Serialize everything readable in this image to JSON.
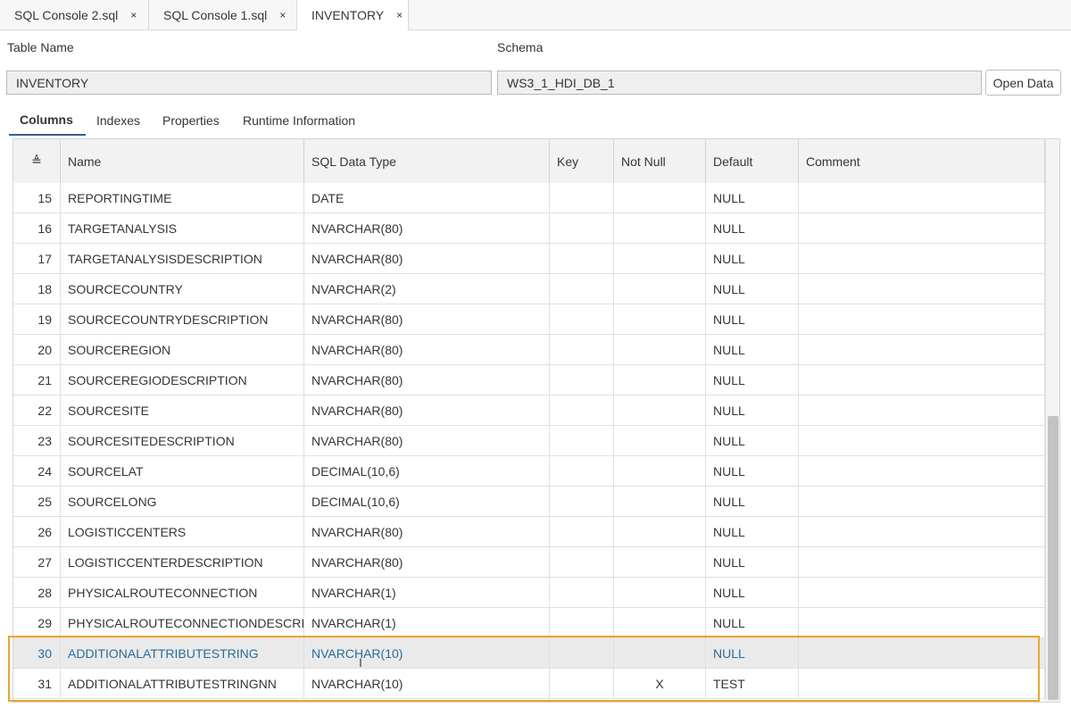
{
  "tabs": [
    {
      "label": "SQL Console 2.sql"
    },
    {
      "label": "SQL Console 1.sql"
    },
    {
      "label": "INVENTORY"
    }
  ],
  "tab_close_glyph": "×",
  "table_name": {
    "label": "Table Name",
    "value": "INVENTORY"
  },
  "schema": {
    "label": "Schema",
    "value": "WS3_1_HDI_DB_1"
  },
  "open_data_label": "Open Data",
  "subtabs": [
    "Columns",
    "Indexes",
    "Properties",
    "Runtime Information"
  ],
  "columns": {
    "sort_glyph": "≜",
    "headers": [
      "Name",
      "SQL Data Type",
      "Key",
      "Not Null",
      "Default",
      "Comment"
    ],
    "rows": [
      {
        "num": "15",
        "name": "REPORTINGTIME",
        "type": "DATE",
        "key": "",
        "notnull": "",
        "default": "NULL",
        "comment": ""
      },
      {
        "num": "16",
        "name": "TARGETANALYSIS",
        "type": "NVARCHAR(80)",
        "key": "",
        "notnull": "",
        "default": "NULL",
        "comment": ""
      },
      {
        "num": "17",
        "name": "TARGETANALYSISDESCRIPTION",
        "type": "NVARCHAR(80)",
        "key": "",
        "notnull": "",
        "default": "NULL",
        "comment": ""
      },
      {
        "num": "18",
        "name": "SOURCECOUNTRY",
        "type": "NVARCHAR(2)",
        "key": "",
        "notnull": "",
        "default": "NULL",
        "comment": ""
      },
      {
        "num": "19",
        "name": "SOURCECOUNTRYDESCRIPTION",
        "type": "NVARCHAR(80)",
        "key": "",
        "notnull": "",
        "default": "NULL",
        "comment": ""
      },
      {
        "num": "20",
        "name": "SOURCEREGION",
        "type": "NVARCHAR(80)",
        "key": "",
        "notnull": "",
        "default": "NULL",
        "comment": ""
      },
      {
        "num": "21",
        "name": "SOURCEREGIODESCRIPTION",
        "type": "NVARCHAR(80)",
        "key": "",
        "notnull": "",
        "default": "NULL",
        "comment": ""
      },
      {
        "num": "22",
        "name": "SOURCESITE",
        "type": "NVARCHAR(80)",
        "key": "",
        "notnull": "",
        "default": "NULL",
        "comment": ""
      },
      {
        "num": "23",
        "name": "SOURCESITEDESCRIPTION",
        "type": "NVARCHAR(80)",
        "key": "",
        "notnull": "",
        "default": "NULL",
        "comment": ""
      },
      {
        "num": "24",
        "name": "SOURCELAT",
        "type": "DECIMAL(10,6)",
        "key": "",
        "notnull": "",
        "default": "NULL",
        "comment": ""
      },
      {
        "num": "25",
        "name": "SOURCELONG",
        "type": "DECIMAL(10,6)",
        "key": "",
        "notnull": "",
        "default": "NULL",
        "comment": ""
      },
      {
        "num": "26",
        "name": "LOGISTICCENTERS",
        "type": "NVARCHAR(80)",
        "key": "",
        "notnull": "",
        "default": "NULL",
        "comment": ""
      },
      {
        "num": "27",
        "name": "LOGISTICCENTERDESCRIPTION",
        "type": "NVARCHAR(80)",
        "key": "",
        "notnull": "",
        "default": "NULL",
        "comment": ""
      },
      {
        "num": "28",
        "name": "PHYSICALROUTECONNECTION",
        "type": "NVARCHAR(1)",
        "key": "",
        "notnull": "",
        "default": "NULL",
        "comment": ""
      },
      {
        "num": "29",
        "name": "PHYSICALROUTECONNECTIONDESCRI",
        "type": "NVARCHAR(1)",
        "key": "",
        "notnull": "",
        "default": "NULL",
        "comment": ""
      },
      {
        "num": "30",
        "name": "ADDITIONALATTRIBUTESTRING",
        "type": "NVARCHAR(10)",
        "key": "",
        "notnull": "",
        "default": "NULL",
        "comment": ""
      },
      {
        "num": "31",
        "name": "ADDITIONALATTRIBUTESTRINGNN",
        "type": "NVARCHAR(10)",
        "key": "",
        "notnull": "X",
        "default": "TEST",
        "comment": ""
      }
    ],
    "selected_row": "30"
  },
  "colors": {
    "accent": "#346187",
    "highlight_border": "#e7a829",
    "selected_text": "#2a6b9b"
  }
}
